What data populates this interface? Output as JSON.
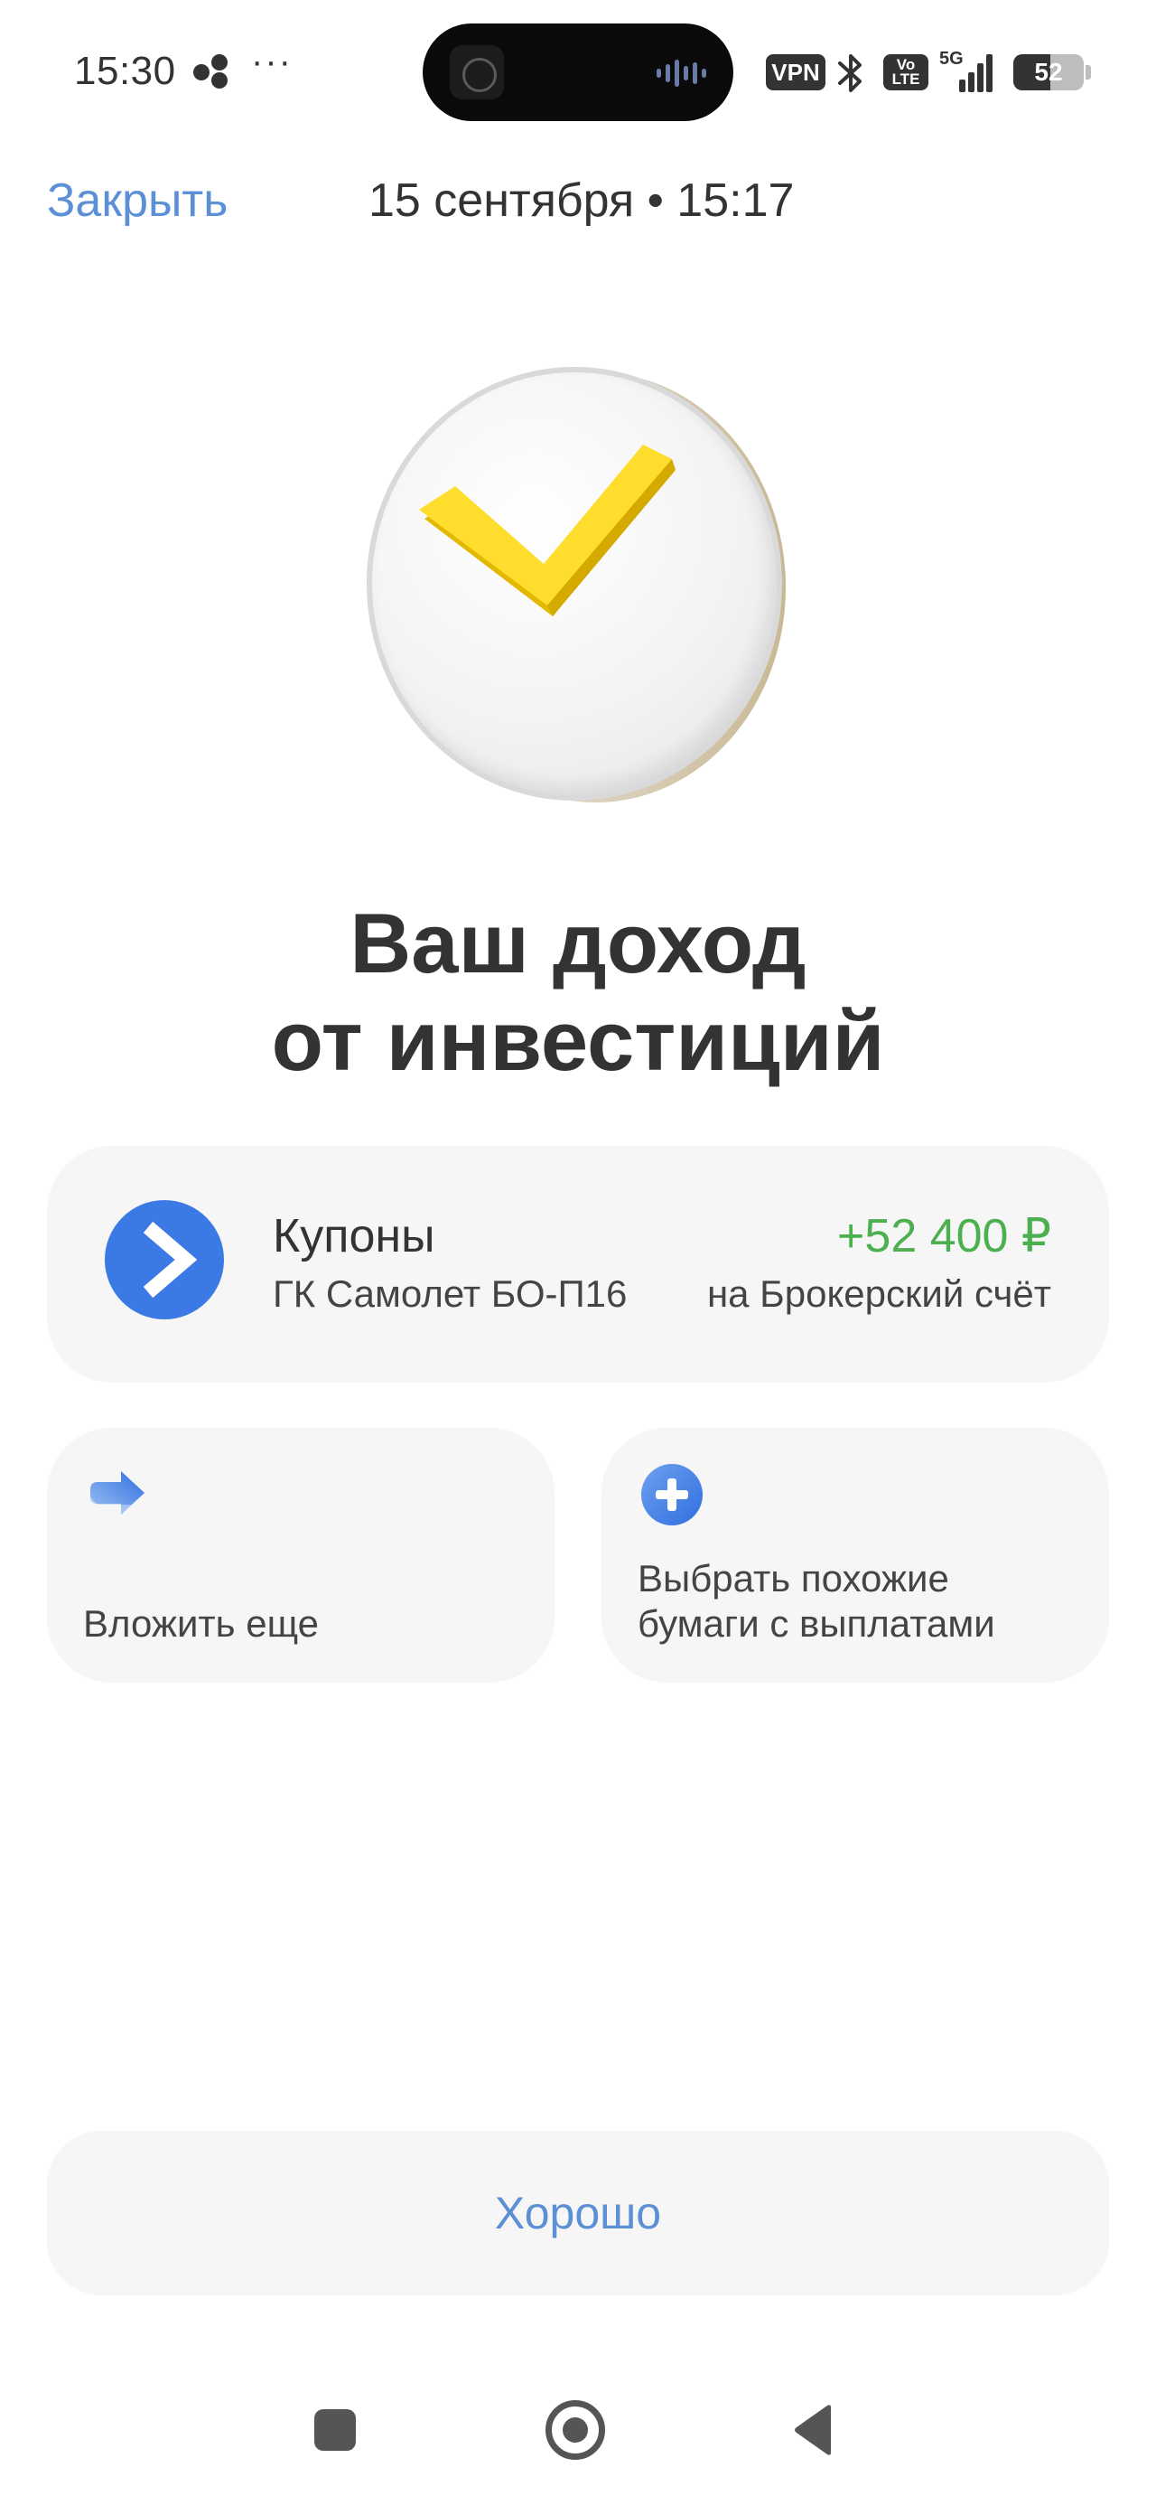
{
  "status_bar": {
    "time": "15:30",
    "more": "···",
    "vpn": "VPN",
    "volte": "Vo LTE",
    "network": "5G",
    "battery": "52",
    "battery_level": 0.52,
    "icons": [
      "app-dots-icon",
      "bluetooth-icon",
      "signal-icon",
      "battery-icon"
    ]
  },
  "header": {
    "close_label": "Закрыть",
    "date": "15 сентября • 15:17"
  },
  "hero": {
    "icon": "checkmark-coin-icon",
    "colors": {
      "check": "#ffdd2d",
      "coin": "#f2f2f2"
    }
  },
  "title": {
    "line1": "Ваш доход",
    "line2": "от инвестиций"
  },
  "coupon": {
    "icon": "samolet-logo-icon",
    "title": "Купоны",
    "subtitle": "ГК Самолет БО-П16",
    "amount": "+52 400 ₽",
    "destination": "на Брокерский счёт",
    "colors": {
      "amount": "#4caf50",
      "logo_bg": "#3b79e4"
    }
  },
  "actions": [
    {
      "icon": "share-arrow-icon",
      "label_lines": [
        "Вложить еще"
      ]
    },
    {
      "icon": "plus-circle-icon",
      "label_lines": [
        "Выбрать похожие",
        "бумаги с выплатами"
      ]
    }
  ],
  "ok_button": {
    "label": "Хорошо"
  },
  "nav_bar": {
    "buttons": [
      "recents-icon",
      "home-icon",
      "back-icon"
    ]
  },
  "colors": {
    "accent": "#5b8fd6",
    "card_bg": "#f5f6f5",
    "text": "#333333"
  }
}
